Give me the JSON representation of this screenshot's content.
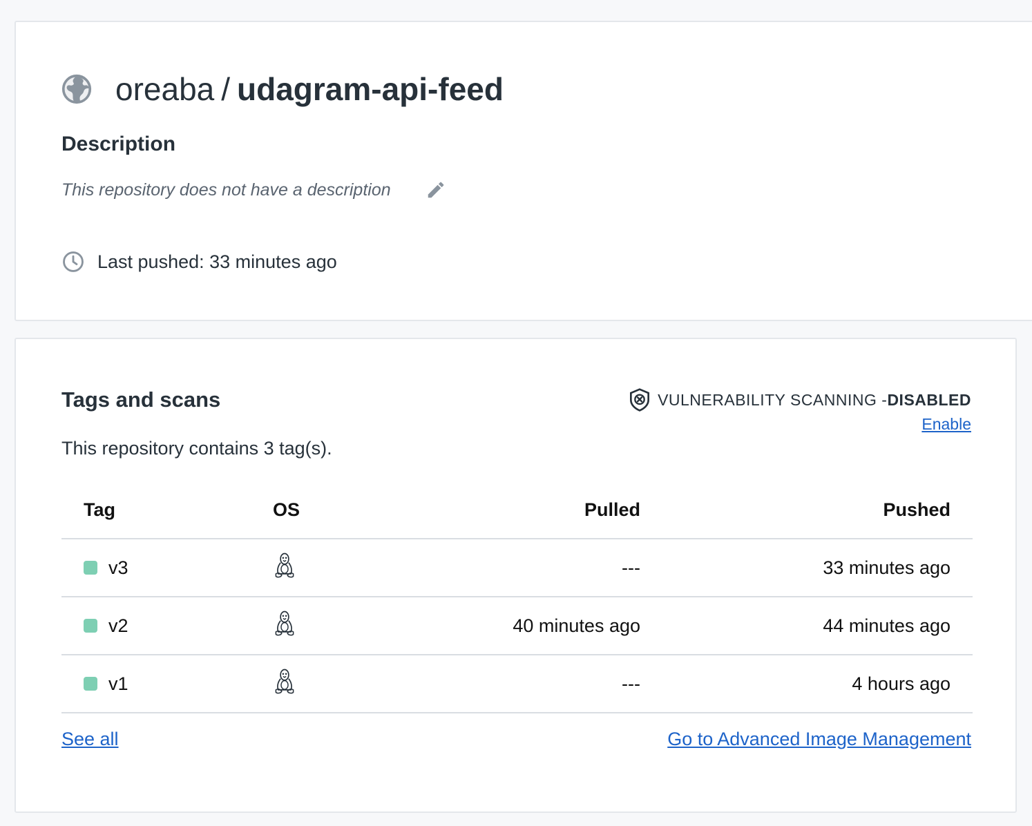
{
  "repository": {
    "owner": "oreaba",
    "separator": "/",
    "name": "udagram-api-feed",
    "visibility_icon": "globe-icon"
  },
  "description": {
    "heading": "Description",
    "text": "This repository does not have a description",
    "edit_icon": "pencil-icon"
  },
  "last_pushed": {
    "icon": "clock-icon",
    "text": "Last pushed: 33 minutes ago"
  },
  "tags_section": {
    "heading": "Tags and scans",
    "count_text": "This repository contains 3 tag(s).",
    "vulnerability": {
      "icon": "shield-x-icon",
      "label": "VULNERABILITY SCANNING - ",
      "status": "DISABLED",
      "enable_label": "Enable"
    },
    "columns": {
      "tag": "Tag",
      "os": "OS",
      "pulled": "Pulled",
      "pushed": "Pushed"
    },
    "rows": [
      {
        "tag": "v3",
        "os_icon": "linux-icon",
        "pulled": "---",
        "pushed": "33 minutes ago"
      },
      {
        "tag": "v2",
        "os_icon": "linux-icon",
        "pulled": "40 minutes ago",
        "pushed": "44 minutes ago"
      },
      {
        "tag": "v1",
        "os_icon": "linux-icon",
        "pulled": "---",
        "pushed": "4 hours ago"
      }
    ],
    "see_all_label": "See all",
    "advanced_label": "Go to Advanced Image Management"
  },
  "colors": {
    "link": "#1d63c9",
    "status_dot": "#7ecfb3",
    "text": "#27313a",
    "icon_gray": "#8a949e"
  }
}
